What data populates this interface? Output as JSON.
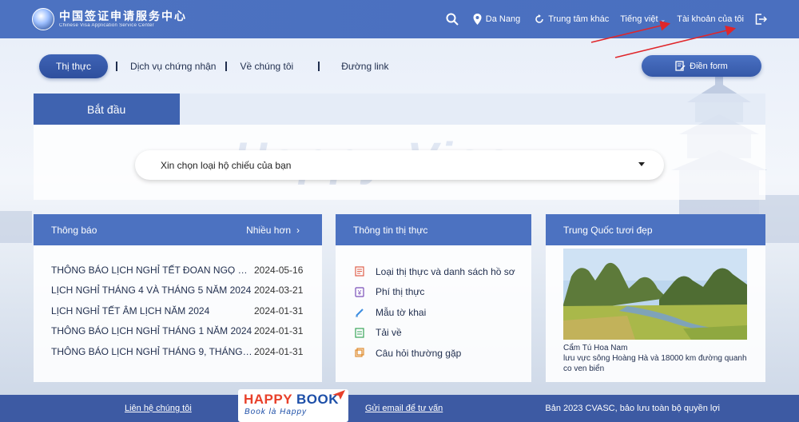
{
  "header": {
    "logo_cn": "中国签证申请服务中心",
    "logo_en": "Chinese Visa Application Service Center",
    "location": "Da Nang",
    "other_center": "Trung tâm khác",
    "language": "Tiếng việt",
    "account": "Tài khoản của tôi",
    "icons": [
      "search-icon",
      "location-pin-icon",
      "refresh-icon",
      "chevron-down-icon",
      "logout-icon"
    ]
  },
  "nav": {
    "active": "Thị thực",
    "items": [
      "Dịch vụ chứng nhận",
      "Về chúng tôi",
      "Đường link"
    ],
    "fill_form": "Điền form"
  },
  "start": {
    "tab": "Bắt đầu",
    "select_placeholder": "Xin chọn loại hộ chiếu của bạn"
  },
  "notice": {
    "title": "Thông báo",
    "more": "Nhiều hơn",
    "items": [
      {
        "title": "THÔNG BÁO LỊCH NGHỈ TẾT ĐOAN NGỌ NĂM...",
        "date": "2024-05-16"
      },
      {
        "title": "LỊCH NGHỈ THÁNG 4 VÀ THÁNG 5 NĂM 2024",
        "date": "2024-03-21"
      },
      {
        "title": "LỊCH NGHỈ TẾT ÂM LỊCH NĂM 2024",
        "date": "2024-01-31"
      },
      {
        "title": "THÔNG BÁO LỊCH NGHỈ THÁNG 1 NĂM 2024",
        "date": "2024-01-31"
      },
      {
        "title": "THÔNG BÁO LỊCH NGHỈ THÁNG 9, THÁNG 10...",
        "date": "2024-01-31"
      }
    ]
  },
  "visa_info": {
    "title": "Thông tin thị thực",
    "items": [
      "Loại thị thực và danh sách hồ sơ",
      "Phí thị thực",
      "Mẫu tờ khai",
      "Tải về",
      "Câu hỏi thường gặp"
    ]
  },
  "china": {
    "title": "Trung Quốc tươi đẹp",
    "caption_title": "Cẩm Tú Hoa Nam",
    "caption_text": "lưu vực sông Hoàng Hà và 18000 km đường quanh co ven biển"
  },
  "footer": {
    "contact": "Liên hệ chúng tôi",
    "email": "Gửi email để tư vấn",
    "copyright": "Bản 2023 CVASC, bảo lưu toàn bộ quyền lợi"
  },
  "watermark": {
    "brand_top1": "HAPPY",
    "brand_top2": "BOOK",
    "brand_sub": "Book là Happy",
    "background": "Happy Visa"
  },
  "colors": {
    "header_blue": "#4c72c1",
    "nav_active": "#3e63b5",
    "footer_blue": "#3d5aa3",
    "arrow_red": "#e0262a"
  }
}
